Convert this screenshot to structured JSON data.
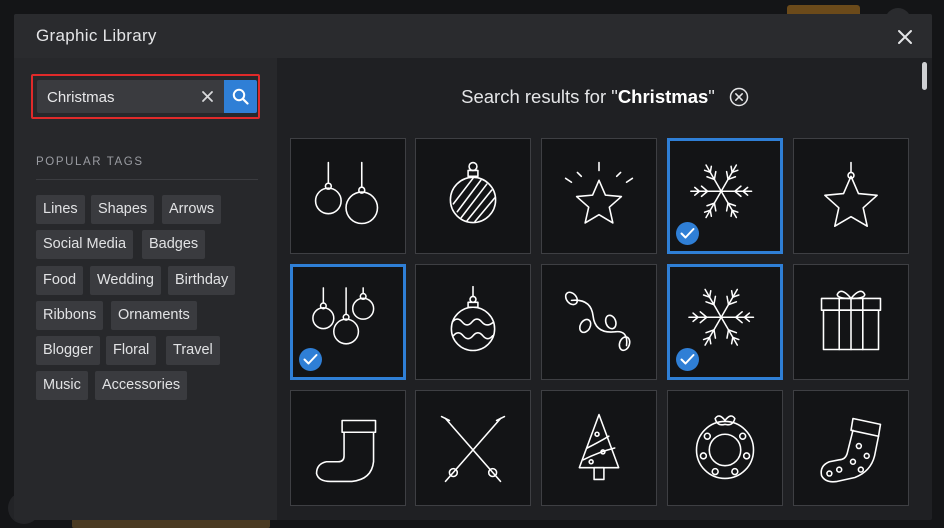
{
  "modal": {
    "title": "Graphic Library"
  },
  "search": {
    "value": "Christmas",
    "placeholder": ""
  },
  "popular_tags": {
    "heading": "POPULAR TAGS",
    "tags": [
      "Lines",
      "Shapes",
      "Arrows",
      "Social Media",
      "Badges",
      "Food",
      "Wedding",
      "Birthday",
      "Ribbons",
      "Ornaments",
      "Blogger",
      "Floral",
      "Travel",
      "Music",
      "Accessories"
    ]
  },
  "results": {
    "prefix": "Search results for \"",
    "query": "Christmas",
    "suffix": "\""
  },
  "graphics": [
    {
      "icon": "two-ornaments-icon",
      "selected": false
    },
    {
      "icon": "striped-ornament-icon",
      "selected": false
    },
    {
      "icon": "shining-star-icon",
      "selected": false
    },
    {
      "icon": "snowflake-icon",
      "selected": true
    },
    {
      "icon": "hanging-star-icon",
      "selected": false
    },
    {
      "icon": "three-ornaments-icon",
      "selected": true
    },
    {
      "icon": "wavy-ornament-icon",
      "selected": false
    },
    {
      "icon": "string-lights-icon",
      "selected": false
    },
    {
      "icon": "snowflake-alt-icon",
      "selected": true
    },
    {
      "icon": "gift-box-icon",
      "selected": false
    },
    {
      "icon": "stocking-icon",
      "selected": false
    },
    {
      "icon": "crossed-ski-poles-icon",
      "selected": false
    },
    {
      "icon": "christmas-tree-icon",
      "selected": false
    },
    {
      "icon": "wreath-icon",
      "selected": false
    },
    {
      "icon": "dotted-stocking-icon",
      "selected": false
    }
  ],
  "colors": {
    "accent": "#2f7fd6",
    "highlight": "#e02a2a",
    "modal_bg": "#1f2023",
    "sidebar_bg": "#27282b",
    "tile_bg": "#131416"
  }
}
